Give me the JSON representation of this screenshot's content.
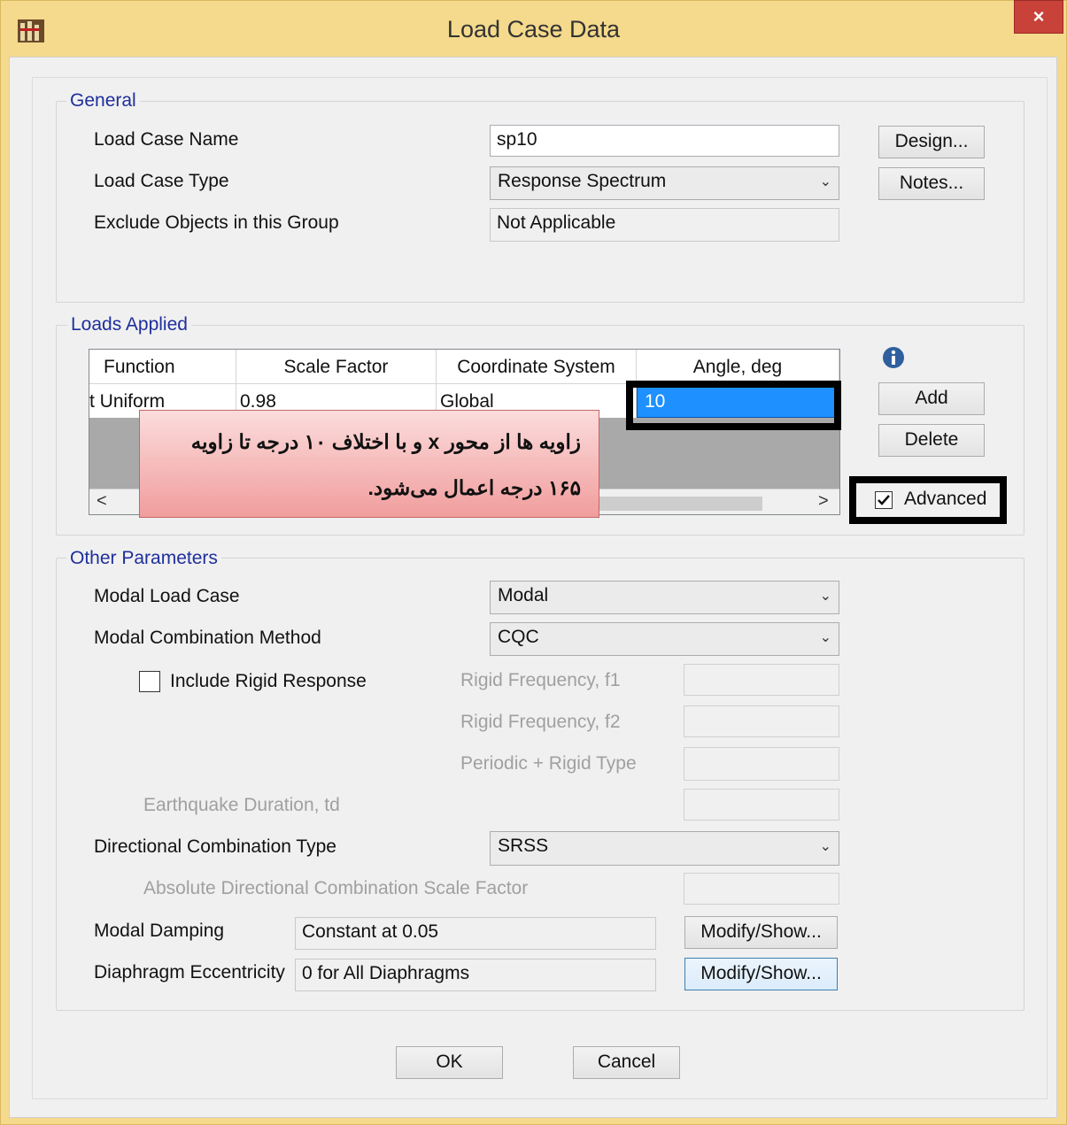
{
  "window": {
    "title": "Load Case Data",
    "close_glyph": "×"
  },
  "general": {
    "group_label": "General",
    "load_case_name_label": "Load Case Name",
    "load_case_name_value": "sp10",
    "load_case_type_label": "Load Case Type",
    "load_case_type_value": "Response Spectrum",
    "exclude_label": "Exclude Objects in this Group",
    "exclude_value": "Not Applicable",
    "design_button": "Design...",
    "notes_button": "Notes..."
  },
  "loads_applied": {
    "group_label": "Loads Applied",
    "columns": [
      "Function",
      "Scale Factor",
      "Coordinate System",
      "Angle, deg"
    ],
    "rows": [
      {
        "function": "t Uniform",
        "scale_factor": "0.98",
        "coordinate_system": "Global",
        "angle": "10"
      }
    ],
    "add_button": "Add",
    "delete_button": "Delete",
    "advanced_label": "Advanced",
    "advanced_checked": true,
    "scroll_left": "<",
    "scroll_right": ">"
  },
  "annotation": {
    "line1": "زاویه ها از محور x و با اختلاف ۱۰ درجه تا زاویه",
    "line2": "۱۶۵ درجه اعمال می‌شود."
  },
  "other_parameters": {
    "group_label": "Other Parameters",
    "modal_load_case_label": "Modal Load Case",
    "modal_load_case_value": "Modal",
    "modal_combination_label": "Modal Combination Method",
    "modal_combination_value": "CQC",
    "include_rigid_label": "Include Rigid Response",
    "include_rigid_checked": false,
    "rigid_f1_label": "Rigid Frequency, f1",
    "rigid_f2_label": "Rigid Frequency, f2",
    "periodic_rigid_label": "Periodic + Rigid Type",
    "earthquake_duration_label": "Earthquake Duration, td",
    "directional_combination_label": "Directional Combination Type",
    "directional_combination_value": "SRSS",
    "absolute_scale_label": "Absolute Directional Combination Scale Factor",
    "modal_damping_label": "Modal Damping",
    "modal_damping_value": "Constant at 0.05",
    "diaphragm_label": "Diaphragm Eccentricity",
    "diaphragm_value": "0 for All Diaphragms",
    "modify_show_1": "Modify/Show...",
    "modify_show_2": "Modify/Show..."
  },
  "footer": {
    "ok_button": "OK",
    "cancel_button": "Cancel"
  },
  "colors": {
    "title_bar": "#f5d98c",
    "close_button": "#c8423a",
    "group_label": "#1f2f9c",
    "selected_cell": "#1e90ff",
    "annotation_fill": "#f3a9a9"
  }
}
